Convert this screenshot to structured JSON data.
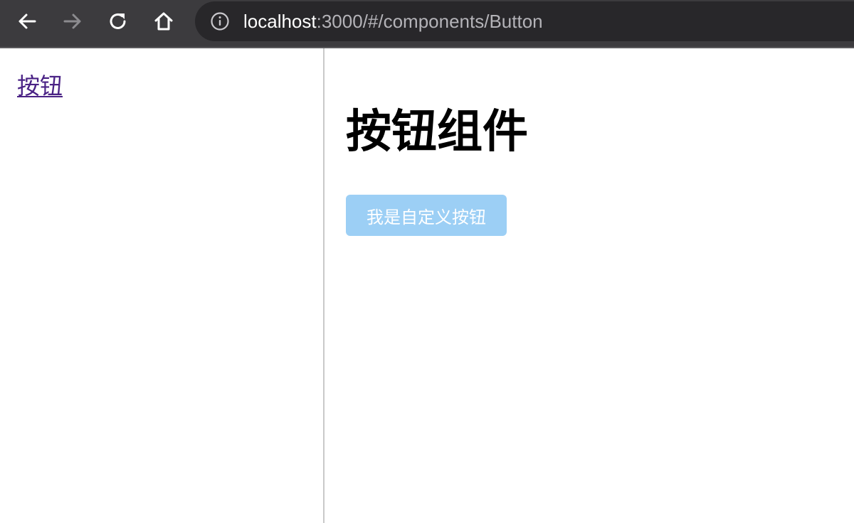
{
  "browser": {
    "url_host": "localhost",
    "url_path": ":3000/#/components/Button",
    "icons": {
      "back": "back-arrow-icon",
      "forward": "forward-arrow-icon",
      "reload": "reload-icon",
      "home": "home-icon",
      "info": "info-icon"
    },
    "forward_disabled": true
  },
  "sidebar": {
    "items": [
      {
        "label": "按钮"
      }
    ]
  },
  "main": {
    "title": "按钮组件",
    "custom_button_label": "我是自定义按钮"
  },
  "colors": {
    "toolbar_bg": "#3c3b3e",
    "address_bar_bg": "#28272a",
    "link_visited": "#4a2285",
    "button_bg": "#9ccff5",
    "button_text": "#ffffff"
  }
}
